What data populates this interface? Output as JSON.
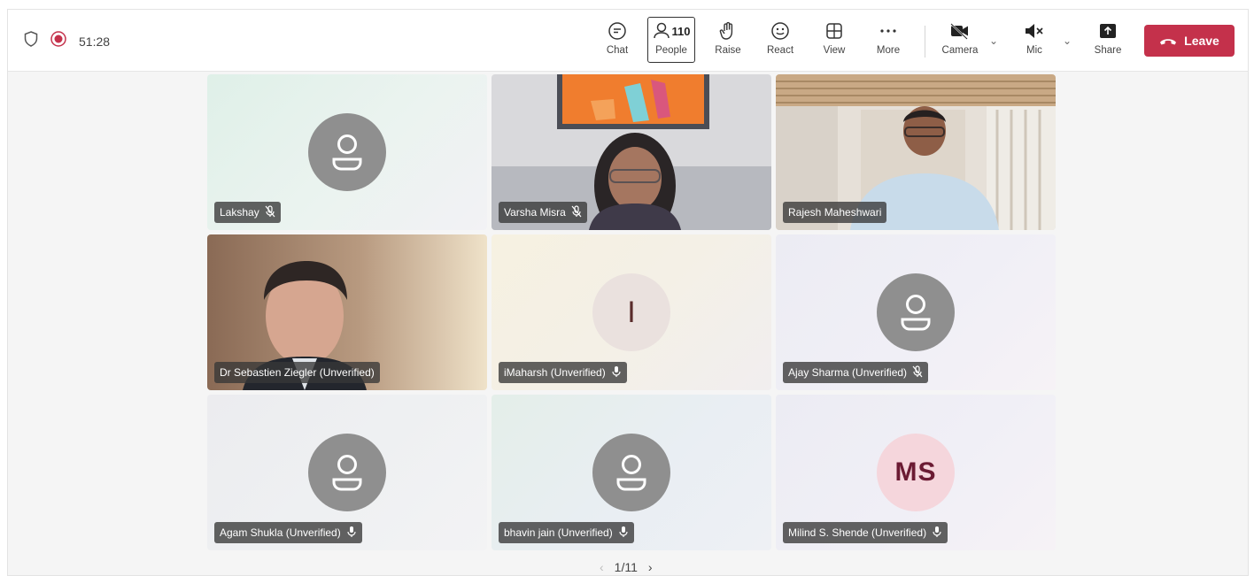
{
  "status": {
    "timer": "51:28"
  },
  "toolbar": {
    "chat": "Chat",
    "people": "People",
    "people_count": "110",
    "raise": "Raise",
    "react": "React",
    "view": "View",
    "more": "More",
    "camera": "Camera",
    "mic": "Mic",
    "share": "Share",
    "leave": "Leave"
  },
  "participants": [
    {
      "name": "Lakshay",
      "avatar": "person-icon",
      "mic": "muted"
    },
    {
      "name": "Varsha Misra",
      "avatar": "video",
      "mic": "muted"
    },
    {
      "name": "Rajesh Maheshwari",
      "avatar": "video",
      "mic": "none"
    },
    {
      "name": "Dr Sebastien Ziegler (Unverified)",
      "avatar": "video",
      "mic": "none"
    },
    {
      "name": "iMaharsh (Unverified)",
      "avatar": "I",
      "mic": "on"
    },
    {
      "name": "Ajay Sharma (Unverified)",
      "avatar": "person-icon",
      "mic": "muted"
    },
    {
      "name": "Agam Shukla (Unverified)",
      "avatar": "person-icon",
      "mic": "on"
    },
    {
      "name": "bhavin jain (Unverified)",
      "avatar": "person-icon",
      "mic": "on"
    },
    {
      "name": "Milind S. Shende (Unverified)",
      "avatar": "MS",
      "mic": "on"
    }
  ],
  "pager": {
    "label": "1/11"
  },
  "colors": {
    "leave": "#c4314b",
    "record": "#c4314b"
  }
}
